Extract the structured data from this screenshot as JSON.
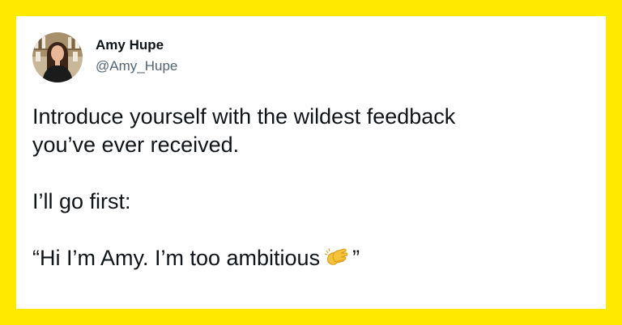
{
  "author": {
    "name": "Amy Hupe",
    "handle": "@Amy_Hupe"
  },
  "tweet": {
    "line1": "Introduce yourself with the wildest feedback",
    "line2": "you’ve ever received.",
    "line3": "I’ll go first:",
    "quote_start": "“Hi I’m Amy. I’m too ambitious",
    "quote_end": "”",
    "emoji_icon": "clapping-hands-icon"
  },
  "colors": {
    "background": "#FFE900",
    "card": "#FFFFFF",
    "text": "#0F1419",
    "handle": "#536471"
  }
}
